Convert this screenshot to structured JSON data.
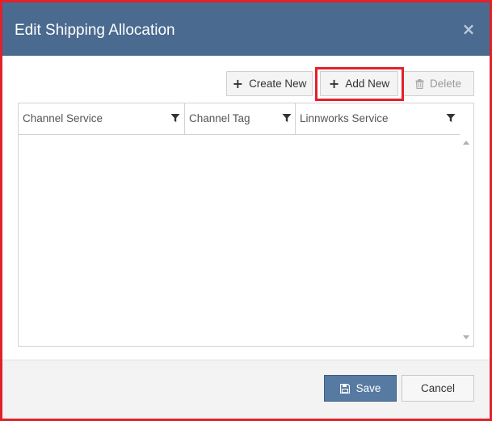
{
  "dialog": {
    "title": "Edit Shipping Allocation",
    "close_glyph": "×"
  },
  "toolbar": {
    "create_label": "Create New",
    "add_label": "Add New",
    "delete_label": "Delete",
    "plus_glyph": "+"
  },
  "grid": {
    "columns": [
      {
        "label": "Channel Service"
      },
      {
        "label": "Channel Tag"
      },
      {
        "label": "Linnworks Service"
      }
    ],
    "rows": []
  },
  "footer": {
    "save_label": "Save",
    "cancel_label": "Cancel"
  },
  "icons": {
    "close": "close-icon",
    "plus": "plus-icon",
    "trash": "trash-icon",
    "filter": "filter-icon",
    "save": "floppy-disk-icon"
  },
  "colors": {
    "highlight": "#e0222b",
    "titlebar": "#4a6a8f",
    "primary_button": "#577aa3"
  }
}
